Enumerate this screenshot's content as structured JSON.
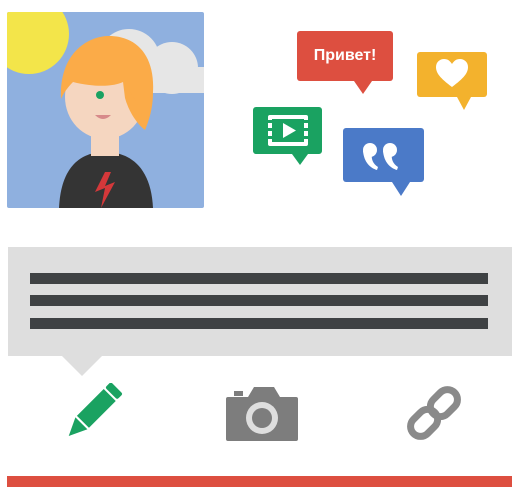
{
  "greeting_bubble": {
    "text": "Привет!",
    "color": "#dd4f40"
  },
  "colors": {
    "avatar_background": "#8fb0df",
    "sun": "#f3e54a",
    "cloud": "#e6e6e6",
    "hair": "#fbab48",
    "shirt": "#343434",
    "bolt": "#d4383a",
    "video_bubble": "#1aa261",
    "quote_bubble": "#4b7ac8",
    "heart_bubble": "#f3b22d",
    "composer_background": "#dedede",
    "composer_lines": "#3f4244",
    "pencil": "#1aa261",
    "camera": "#7d7d7d",
    "link": "#8a8a8a",
    "accent_bar": "#dd4f40"
  },
  "icons": {
    "video": "video-play-icon",
    "quote": "quote-icon",
    "heart": "heart-icon",
    "pencil": "pencil-icon",
    "camera": "camera-icon",
    "link": "link-icon"
  }
}
